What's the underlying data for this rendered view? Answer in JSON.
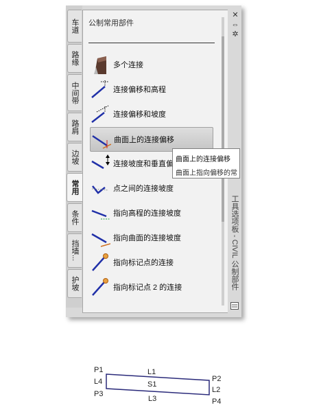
{
  "tabs": [
    {
      "label": "车道"
    },
    {
      "label": "路缘"
    },
    {
      "label": "中间带"
    },
    {
      "label": "路肩"
    },
    {
      "label": "边坡"
    },
    {
      "label": "常用"
    },
    {
      "label": "条件"
    },
    {
      "label": "挡墙..."
    },
    {
      "label": "护坡"
    }
  ],
  "active_tab": "常用",
  "palette": {
    "title": "公制常用部件",
    "vertical_title": "工具选项板 - CIVIL 公制部件",
    "controls": [
      "✕",
      "⇔",
      "✲"
    ]
  },
  "tools": [
    {
      "label": "多个连接",
      "icon": "multiple-links-icon"
    },
    {
      "label": "连接偏移和高程",
      "icon": "link-offset-elevation-icon"
    },
    {
      "label": "连接偏移和坡度",
      "icon": "link-offset-slope-icon"
    },
    {
      "label": "曲面上的连接偏移",
      "icon": "link-offset-on-surface-icon",
      "highlighted": true
    },
    {
      "label": "连接坡度和垂直偏",
      "icon": "link-slope-vertical-offset-icon"
    },
    {
      "label": "点之间的连接坡度",
      "icon": "link-slope-between-points-icon"
    },
    {
      "label": "指向高程的连接坡度",
      "icon": "link-slope-to-elevation-icon"
    },
    {
      "label": "指向曲面的连接坡度",
      "icon": "link-slope-to-surface-icon"
    },
    {
      "label": "指向标记点的连接",
      "icon": "link-to-marked-point-icon"
    },
    {
      "label": "指向标记点 2 的连接",
      "icon": "link-to-marked-point-2-icon"
    }
  ],
  "tooltip": {
    "title": "曲面上的连接偏移",
    "description": "曲面上指向偏移的常"
  },
  "diagram": {
    "points": [
      "P1",
      "P2",
      "P3",
      "P4"
    ],
    "links": [
      "L1",
      "L2",
      "L3",
      "L4"
    ],
    "shape": "S1"
  },
  "colors": {
    "link_blue": "#2030a8",
    "marker_orange": "#e07a20",
    "shape_outline": "#2a2a7a"
  }
}
